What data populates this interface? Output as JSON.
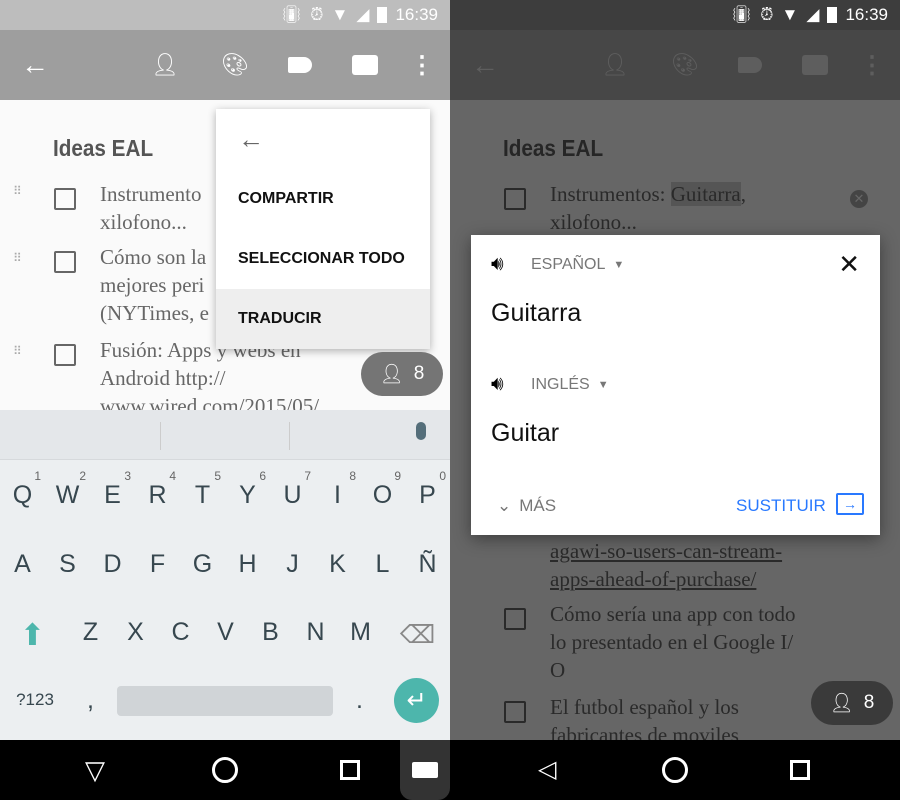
{
  "status": {
    "time": "16:39"
  },
  "note": {
    "title": "Ideas EAL"
  },
  "left": {
    "items": [
      {
        "lines": [
          "Instrumento",
          "xilofono..."
        ]
      },
      {
        "lines": [
          "Cómo son la",
          "mejores peri",
          "(NYTimes, e"
        ]
      },
      {
        "lines": [
          "Fusión: Apps y webs en",
          "Android http://",
          "www.wired.com/2015/05/"
        ]
      }
    ],
    "menu": {
      "items": [
        "COMPARTIR",
        "SELECCIONAR TODO",
        "TRADUCIR"
      ]
    },
    "collaborators_count": "8"
  },
  "keyboard": {
    "row1": [
      [
        "Q",
        "1"
      ],
      [
        "W",
        "2"
      ],
      [
        "E",
        "3"
      ],
      [
        "R",
        "4"
      ],
      [
        "T",
        "5"
      ],
      [
        "Y",
        "6"
      ],
      [
        "U",
        "7"
      ],
      [
        "I",
        "8"
      ],
      [
        "O",
        "9"
      ],
      [
        "P",
        "0"
      ]
    ],
    "row2": [
      "A",
      "S",
      "D",
      "F",
      "G",
      "H",
      "J",
      "K",
      "L",
      "Ñ"
    ],
    "row3": [
      "Z",
      "X",
      "C",
      "V",
      "B",
      "N",
      "M"
    ],
    "symbols_label": "?123",
    "comma": ",",
    "period": ".",
    "accent_color": "#4db6ac"
  },
  "right": {
    "item1": {
      "prefix": "Instrumentos: ",
      "selected": "Guitarra",
      "suffix": ",",
      "line2": "xilofono..."
    },
    "lines_below": [
      "agawi-so-users-can-stream-",
      "apps-ahead-of-purchase/"
    ],
    "item_next": [
      "Cómo sería una app con todo",
      "lo presentado en el Google I/",
      "O"
    ],
    "item_last": [
      "El futbol español y los",
      "fabricantes de moviles"
    ],
    "collaborators_count": "8",
    "translate": {
      "source_lang": "ESPAÑOL",
      "source_text": "Guitarra",
      "target_lang": "INGLÉS",
      "target_text": "Guitar",
      "more_label": "MÁS",
      "replace_label": "SUSTITUIR",
      "accent_color": "#2979ff"
    }
  }
}
